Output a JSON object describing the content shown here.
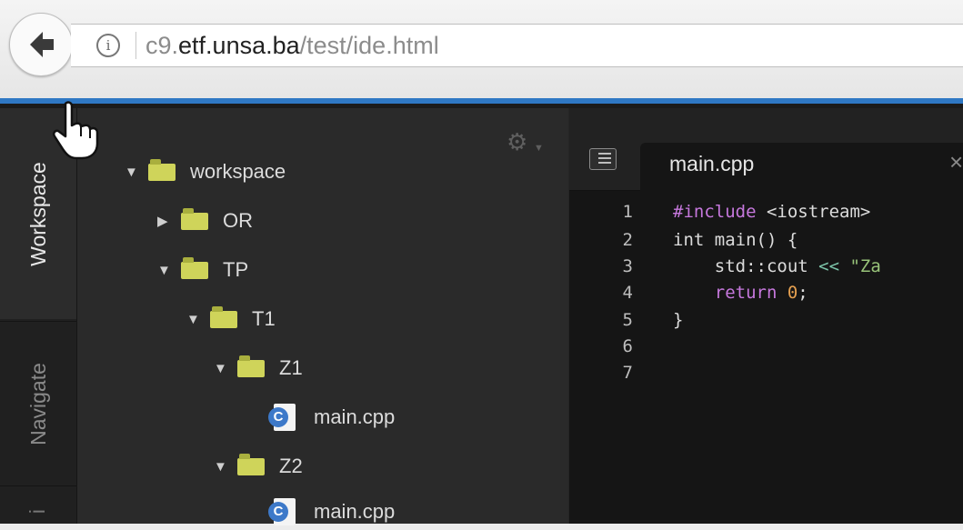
{
  "browser": {
    "url_prefix": "c9.",
    "url_domain": "etf.unsa.ba",
    "url_path": "/test/ide.html"
  },
  "sidebar_tabs": {
    "workspace": "Workspace",
    "navigate": "Navigate",
    "stub": "i"
  },
  "tree": {
    "items": [
      {
        "label": "workspace",
        "type": "folder",
        "expanded": true
      },
      {
        "label": "OR",
        "type": "folder",
        "expanded": false
      },
      {
        "label": "TP",
        "type": "folder",
        "expanded": true
      },
      {
        "label": "T1",
        "type": "folder",
        "expanded": true
      },
      {
        "label": "Z1",
        "type": "folder",
        "expanded": true
      },
      {
        "label": "main.cpp",
        "type": "file"
      },
      {
        "label": "Z2",
        "type": "folder",
        "expanded": true
      },
      {
        "label": "main.cpp",
        "type": "file"
      }
    ]
  },
  "editor": {
    "tab_label": "main.cpp",
    "close_glyph": "×",
    "line_numbers": [
      "1",
      "2",
      "3",
      "4",
      "5",
      "6",
      "7"
    ],
    "lines": {
      "l1_kw": "#include",
      "l1_rest": " <iostream>",
      "l2": "int main() {",
      "l3_a": "    std::cout ",
      "l3_op": "<<",
      "l3_str": " \"Za",
      "l4_kw": "    return ",
      "l4_num": "0",
      "l4_end": ";",
      "l5": "}"
    }
  },
  "colors": {
    "accent_blue": "#2f78c4",
    "folder": "#cfd45a",
    "file_badge": "#3d79c9"
  }
}
